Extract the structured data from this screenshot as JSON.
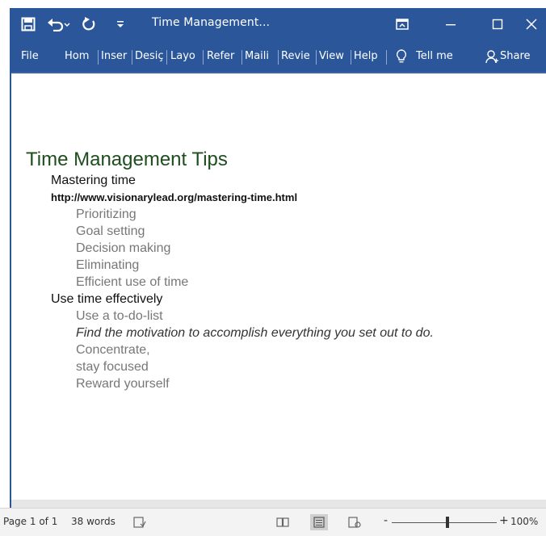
{
  "window": {
    "title": "Time Management...",
    "accent": "#2b579a"
  },
  "ribbon": {
    "tabs": [
      "File",
      "Hom",
      "Inser",
      "Desiç",
      "Layo",
      "Refer",
      "Maili",
      "Revie",
      "View",
      "Help"
    ],
    "tell_me": "Tell me",
    "share": "Share"
  },
  "document": {
    "title": "Time Management Tips",
    "section1": {
      "heading": "Mastering time",
      "url": "http://www.visionarylead.org/mastering-time.html",
      "items": [
        "Prioritizing",
        "Goal setting",
        "Decision making",
        "Eliminating",
        "Efficient use of time"
      ]
    },
    "section2": {
      "heading": "Use time effectively",
      "items": [
        "Use a to-do-list",
        "Find the motivation to accomplish everything you set out to do.",
        "Concentrate,",
        "stay focused",
        "Reward yourself"
      ]
    }
  },
  "status": {
    "page": "Page 1 of 1",
    "words": "38 words",
    "zoom_minus": "-",
    "zoom_plus": "+",
    "zoom": "100%"
  },
  "icons": [
    "save-icon",
    "undo-icon",
    "redo-icon",
    "customize-qat-icon",
    "ribbon-display-icon",
    "minimize-icon",
    "maximize-icon",
    "close-icon",
    "lightbulb-icon",
    "share-person-icon",
    "proofing-icon",
    "read-mode-icon",
    "print-layout-icon",
    "web-layout-icon"
  ]
}
